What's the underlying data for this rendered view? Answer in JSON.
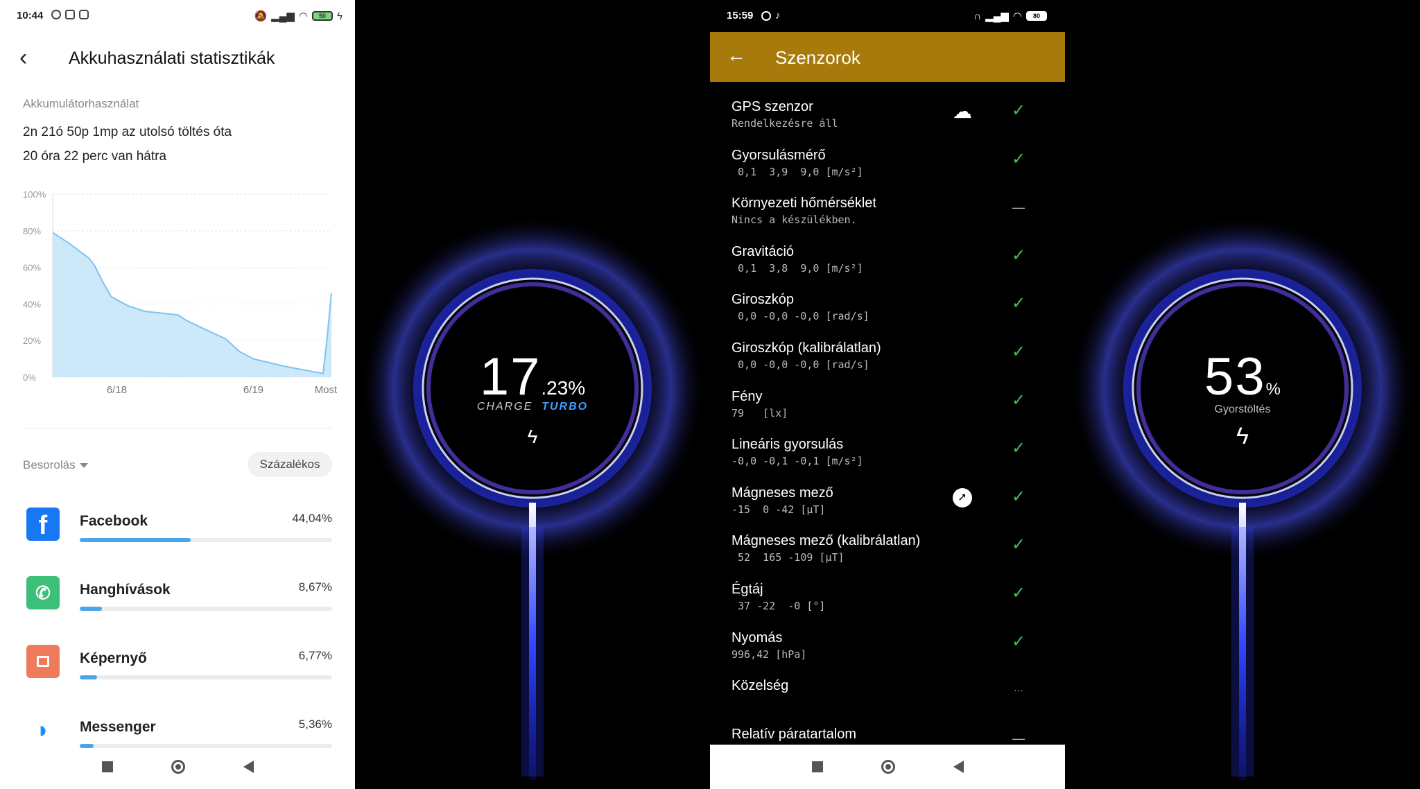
{
  "battery_panel": {
    "status": {
      "time": "10:44",
      "battery": "50"
    },
    "title": "Akkuhasználati statisztikák",
    "section_label": "Akkumulátorhasználat",
    "since_charge": "2n 21ó 50p 1mp az utolsó töltés óta",
    "remaining": "20 óra 22 perc van hátra",
    "sort_label": "Besorolás",
    "percent_button": "Százalékos",
    "apps": [
      {
        "name": "Facebook",
        "percent": "44,04%",
        "fraction": 0.44,
        "color": "#1877f2",
        "icon": "facebook-icon"
      },
      {
        "name": "Hanghívások",
        "percent": "8,67%",
        "fraction": 0.087,
        "color": "#3cbf78",
        "icon": "phone-icon"
      },
      {
        "name": "Képernyő",
        "percent": "6,77%",
        "fraction": 0.068,
        "color": "#f07a5c",
        "icon": "screen-icon"
      },
      {
        "name": "Messenger",
        "percent": "5,36%",
        "fraction": 0.054,
        "color": "#ffffff",
        "icon": "messenger-icon"
      }
    ]
  },
  "chart_data": {
    "type": "area",
    "x_ticks": [
      "6/18",
      "6/19",
      "Most"
    ],
    "y_ticks": [
      "100%",
      "80%",
      "60%",
      "40%",
      "20%",
      "0%"
    ],
    "ylim": [
      0,
      100
    ],
    "x": [
      0,
      0.06,
      0.13,
      0.15,
      0.18,
      0.21,
      0.27,
      0.33,
      0.45,
      0.48,
      0.52,
      0.62,
      0.67,
      0.72,
      0.83,
      0.9,
      0.97,
      0.985,
      1.0
    ],
    "values": [
      79,
      73,
      65,
      61,
      52,
      44,
      39,
      36,
      34,
      31,
      28,
      21,
      14,
      10,
      6,
      4,
      2,
      22,
      46
    ],
    "line_color": "#7cc4ee",
    "fill_color": "#bfe2f7"
  },
  "charge_panel_1": {
    "percent_int": "17",
    "percent_frac": ".23%",
    "charge_label": "CHARGE",
    "turbo_label": "TURBO",
    "accent": "#4a55ff"
  },
  "sensor_panel": {
    "status": {
      "time": "15:59",
      "battery": "80"
    },
    "title": "Szenzorok",
    "header_color": "#a87a0b",
    "sensors": [
      {
        "name": "GPS szenzor",
        "value": "Rendelkezésre áll",
        "status": "ok",
        "extra": "cloud"
      },
      {
        "name": "Gyorsulásmérő",
        "value": " 0,1  3,9  9,0 [m/s²]",
        "status": "ok"
      },
      {
        "name": "Környezeti hőmérséklet",
        "value": "Nincs a készülékben.",
        "status": "none"
      },
      {
        "name": "Gravitáció",
        "value": " 0,1  3,8  9,0 [m/s²]",
        "status": "ok"
      },
      {
        "name": "Giroszkóp",
        "value": " 0,0 -0,0 -0,0 [rad/s]",
        "status": "ok"
      },
      {
        "name": "Giroszkóp (kalibrálatlan)",
        "value": " 0,0 -0,0 -0,0 [rad/s]",
        "status": "ok"
      },
      {
        "name": "Fény",
        "value": "79   [lx]",
        "status": "ok"
      },
      {
        "name": "Lineáris gyorsulás",
        "value": "-0,0 -0,1 -0,1 [m/s²]",
        "status": "ok"
      },
      {
        "name": "Mágneses mező",
        "value": "-15  0 -42 [μT]",
        "status": "ok",
        "extra": "compass"
      },
      {
        "name": "Mágneses mező (kalibrálatlan)",
        "value": " 52  165 -109 [μT]",
        "status": "ok"
      },
      {
        "name": "Égtáj",
        "value": " 37 -22  -0 [°]",
        "status": "ok"
      },
      {
        "name": "Nyomás",
        "value": "996,42 [hPa]",
        "status": "ok"
      },
      {
        "name": "Közelség",
        "value": "",
        "status": "pending"
      },
      {
        "name": "Relatív páratartalom",
        "value": "",
        "status": "none"
      }
    ]
  },
  "charge_panel_2": {
    "percent_int": "53",
    "percent_sign": "%",
    "label": "Gyorstöltés",
    "accent": "#4a55ff"
  }
}
